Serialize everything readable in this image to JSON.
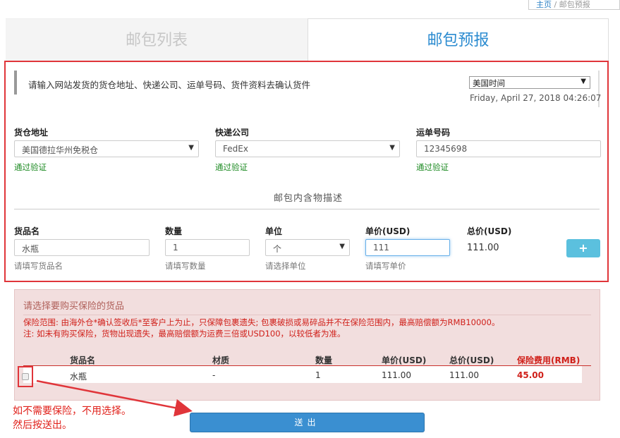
{
  "breadcrumb": {
    "home": "主页",
    "sep": "/",
    "current": "邮包预报"
  },
  "tabs": [
    {
      "label": "邮包列表",
      "active": false
    },
    {
      "label": "邮包预报",
      "active": true
    }
  ],
  "header": {
    "notice": "请输入网站发货的货仓地址、快递公司、运单号码、货件资料去确认货件",
    "timezone_selected": "美国时间",
    "datetime": "Friday, April 27, 2018  04:26:07"
  },
  "shipping": {
    "warehouse": {
      "label": "货仓地址",
      "value": "美国德拉华州免税仓",
      "status": "通过验证"
    },
    "courier": {
      "label": "快递公司",
      "value": "FedEx",
      "status": "通过验证"
    },
    "tracking": {
      "label": "运单号码",
      "value": "12345698",
      "status": "通过验证"
    }
  },
  "contents": {
    "title": "邮包内含物描述",
    "name": {
      "label": "货品名",
      "value": "水瓶",
      "hint": "请填写货品名"
    },
    "qty": {
      "label": "数量",
      "value": "1",
      "hint": "请填写数量"
    },
    "unit": {
      "label": "单位",
      "value": "个",
      "hint": "请选择单位"
    },
    "price": {
      "label": "单价(USD)",
      "value": "111",
      "hint": "请填写单价"
    },
    "total": {
      "label": "总价(USD)",
      "value": "111.00"
    },
    "add_label": "+"
  },
  "insurance": {
    "title": "请选择要购买保险的货品",
    "note1": "保险范围: 由海外仓*确认签收后*至客户上为止，只保障包裹遗失; 包裹破损或易碎品并不在保险范围内，最高赔偿额为RMB10000。",
    "note2": "注: 如未有购买保险，货物出现遗失，最高赔偿额为运费三倍或USD100，以较低者为准。",
    "headers": [
      "货品名",
      "材质",
      "数量",
      "单价(USD)",
      "总价(USD)",
      "保险费用(RMB)"
    ],
    "row": [
      "水瓶",
      "-",
      "1",
      "111.00",
      "111.00",
      "45.00"
    ]
  },
  "submit_label": "送出",
  "annotation": {
    "line1": "如不需要保险，不用选择。",
    "line2": "然后按送出。"
  },
  "colors": {
    "highlight": "#e0353a",
    "accent": "#2b8bd0",
    "valid": "#1c8a22",
    "submit": "#3a8fd1"
  }
}
